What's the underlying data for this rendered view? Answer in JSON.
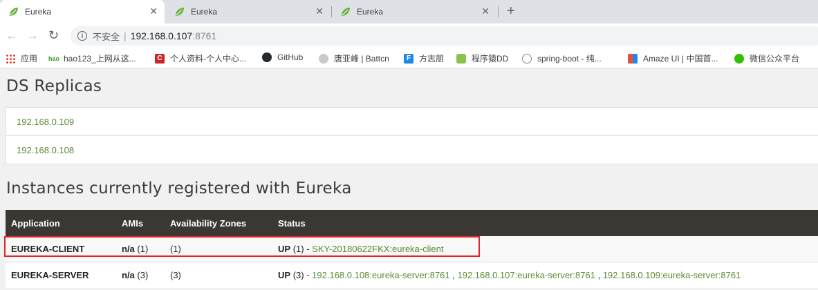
{
  "tabs": [
    {
      "title": "Eureka",
      "active": true
    },
    {
      "title": "Eureka",
      "active": false
    },
    {
      "title": "Eureka",
      "active": false
    }
  ],
  "address": {
    "security_label": "不安全",
    "host": "192.168.0.107",
    "port": ":8761"
  },
  "bookmarks": [
    {
      "label": "应用",
      "icon": "apps-grid-icon"
    },
    {
      "label": "hao123_上网从这...",
      "icon": "hao123-icon"
    },
    {
      "label": "个人资料-个人中心...",
      "icon": "csdn-icon"
    },
    {
      "label": "GitHub",
      "icon": "github-icon"
    },
    {
      "label": "唐亚峰 | Battcn",
      "icon": "avatar-icon"
    },
    {
      "label": "方志朋",
      "icon": "f-letter-icon"
    },
    {
      "label": "程序猿DD",
      "icon": "avatar-icon"
    },
    {
      "label": "spring-boot - 纯...",
      "icon": "site-icon"
    },
    {
      "label": "Amaze UI | 中国首...",
      "icon": "amaze-icon"
    },
    {
      "label": "微信公众平台",
      "icon": "wechat-icon"
    }
  ],
  "replicas": {
    "title": "DS Replicas",
    "items": [
      "192.168.0.109",
      "192.168.0.108"
    ]
  },
  "instances": {
    "title": "Instances currently registered with Eureka",
    "headers": [
      "Application",
      "AMIs",
      "Availability Zones",
      "Status"
    ],
    "rows": [
      {
        "application": "EUREKA-CLIENT",
        "amis_label": "n/a",
        "amis_count": "(1)",
        "zones": "(1)",
        "status_label": "UP",
        "status_count": "(1) -",
        "links": [
          "SKY-20180622FKX:eureka-client"
        ]
      },
      {
        "application": "EUREKA-SERVER",
        "amis_label": "n/a",
        "amis_count": "(3)",
        "zones": "(3)",
        "status_label": "UP",
        "status_count": "(3) -",
        "links": [
          "192.168.0.108:eureka-server:8761",
          "192.168.0.107:eureka-server:8761",
          "192.168.0.109:eureka-server:8761"
        ]
      }
    ]
  },
  "colors": {
    "link_green": "#5a8a2f",
    "header_dark": "#3b3733",
    "highlight_red": "#e0262b"
  }
}
